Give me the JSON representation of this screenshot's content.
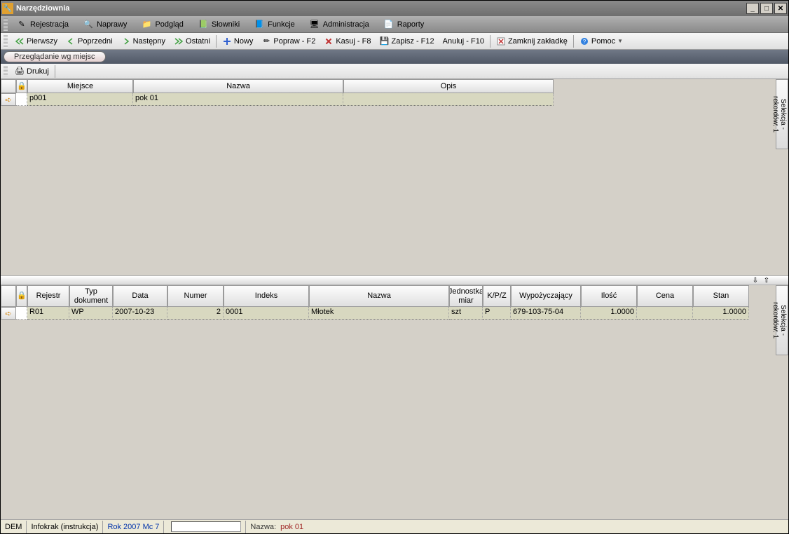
{
  "window": {
    "title": "Narzędziownia"
  },
  "menubar": [
    {
      "label": "Rejestracja",
      "icon": "pen"
    },
    {
      "label": "Naprawy",
      "icon": "wrench"
    },
    {
      "label": "Podgląd",
      "icon": "folder"
    },
    {
      "label": "Słowniki",
      "icon": "dict"
    },
    {
      "label": "Funkcje",
      "icon": "func"
    },
    {
      "label": "Administracja",
      "icon": "admin"
    },
    {
      "label": "Raporty",
      "icon": "report"
    }
  ],
  "toolbar": [
    {
      "label": "Pierwszy",
      "icon": "first"
    },
    {
      "label": "Poprzedni",
      "icon": "prev"
    },
    {
      "label": "Następny",
      "icon": "next"
    },
    {
      "label": "Ostatni",
      "icon": "last"
    },
    {
      "label": "Nowy",
      "icon": "new",
      "sep_before": true
    },
    {
      "label": "Popraw - F2",
      "icon": "edit"
    },
    {
      "label": "Kasuj - F8",
      "icon": "delete"
    },
    {
      "label": "Zapisz - F12",
      "icon": "save"
    },
    {
      "label": "Anuluj - F10",
      "icon": "cancel"
    },
    {
      "label": "Zamknij zakładkę",
      "icon": "close",
      "sep_before": true
    },
    {
      "label": "Pomoc",
      "icon": "help",
      "sep_before": true,
      "dropdown": true
    }
  ],
  "tab": {
    "label": "Przeglądanie wg miejsc"
  },
  "subtoolbar": {
    "print_label": "Drukuj"
  },
  "upper_grid": {
    "columns": [
      "",
      "",
      "Miejsce",
      "Nazwa",
      "Opis"
    ],
    "row": {
      "miejsce": "p001",
      "nazwa": "pok 01",
      "opis": ""
    },
    "side_label": "Selekcja - rekordów: 1"
  },
  "lower_grid": {
    "columns": [
      "",
      "",
      "Rejestr",
      "Typ dokument",
      "Data",
      "Numer",
      "Indeks",
      "Nazwa",
      "Jednostka miar",
      "K/P/Z",
      "Wypożyczający",
      "Ilość",
      "Cena",
      "Stan"
    ],
    "row": {
      "rejestr": "R01",
      "typ": "WP",
      "data": "2007-10-23",
      "numer": "2",
      "indeks": "0001",
      "nazwa": "Młotek",
      "jm": "szt",
      "kpz": "P",
      "wypoz": "679-103-75-04",
      "ilosc": "1.0000",
      "cena": "",
      "stan": "1.0000"
    },
    "side_label": "Selekcja - rekordów: 1"
  },
  "statusbar": {
    "dem": "DEM",
    "infokrak": "Infokrak (instrukcja)",
    "period": "Rok 2007  Mc 7",
    "nazwa_label": "Nazwa:",
    "nazwa_value": "pok 01"
  }
}
